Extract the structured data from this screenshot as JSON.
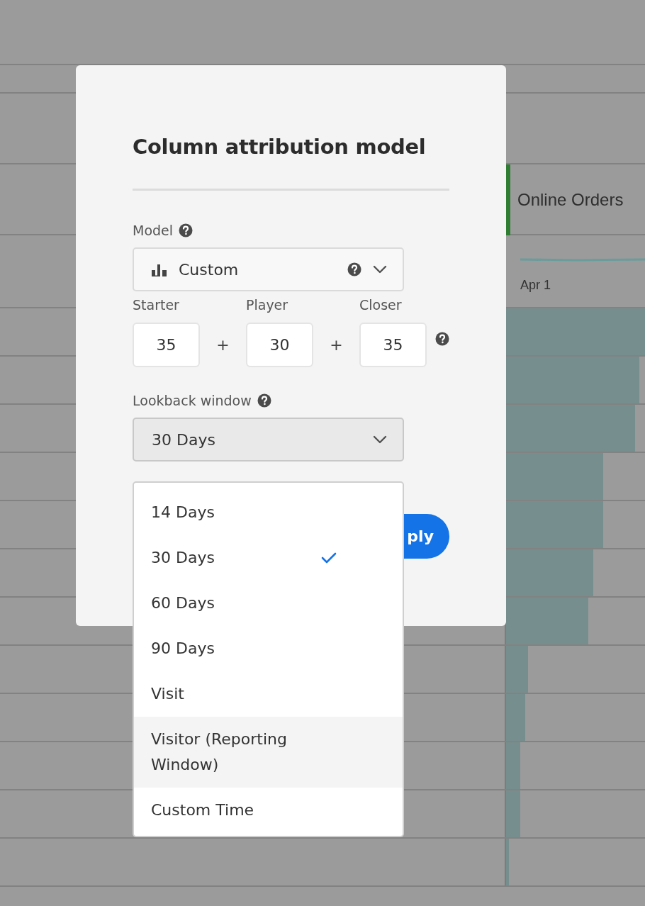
{
  "background_table": {
    "column_header": "Online Orders",
    "date_label": "Apr 1",
    "rows": [
      {
        "level": 1.0
      },
      {
        "level": 0.96
      },
      {
        "level": 0.93
      },
      {
        "level": 0.7
      },
      {
        "level": 0.7
      },
      {
        "level": 0.63
      },
      {
        "level": 0.59
      },
      {
        "level": 0.16
      },
      {
        "level": 0.14
      },
      {
        "level": 0.1
      },
      {
        "level": 0.1
      },
      {
        "level": 0.02
      }
    ]
  },
  "dialog": {
    "title": "Column attribution model",
    "model": {
      "label": "Model",
      "value": "Custom"
    },
    "weights": [
      {
        "label": "Starter",
        "value": "35"
      },
      {
        "label": "Player",
        "value": "30"
      },
      {
        "label": "Closer",
        "value": "35"
      }
    ],
    "weight_separators": [
      "+",
      "+"
    ],
    "lookback": {
      "label": "Lookback window",
      "value": "30 Days",
      "open": true
    },
    "apply_button": "ply"
  },
  "lookback_menu": [
    {
      "label": "14 Days",
      "selected": false,
      "hovered": false
    },
    {
      "label": "30 Days",
      "selected": true,
      "hovered": false
    },
    {
      "label": "60 Days",
      "selected": false,
      "hovered": false
    },
    {
      "label": "90 Days",
      "selected": false,
      "hovered": false
    },
    {
      "label": "Visit",
      "selected": false,
      "hovered": false
    },
    {
      "label": "Visitor (Reporting Window)",
      "selected": false,
      "hovered": true
    },
    {
      "label": "Custom Time",
      "selected": false,
      "hovered": false
    }
  ]
}
